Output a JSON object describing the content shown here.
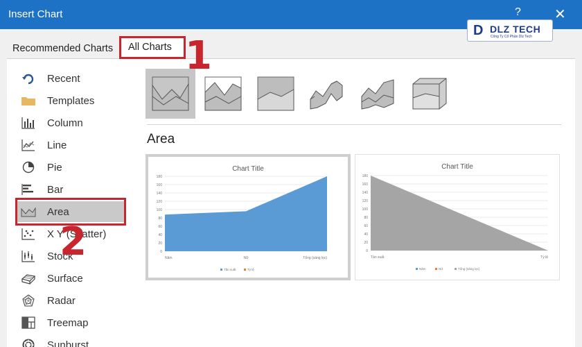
{
  "window": {
    "title": "Insert Chart",
    "help": "?",
    "close": "✕"
  },
  "logo": {
    "mark": "D",
    "word": "DLZ TECH",
    "sub": "Công Ty Cổ Phần Dlz Tech"
  },
  "tabs": [
    {
      "label": "Recommended Charts",
      "selected": false
    },
    {
      "label": "All Charts",
      "selected": true
    }
  ],
  "annotations": {
    "n1": "1",
    "n2": "2"
  },
  "sidebar": {
    "items": [
      {
        "label": "Recent",
        "icon": "recent-icon"
      },
      {
        "label": "Templates",
        "icon": "folder-icon"
      },
      {
        "label": "Column",
        "icon": "column-chart-icon"
      },
      {
        "label": "Line",
        "icon": "line-chart-icon"
      },
      {
        "label": "Pie",
        "icon": "pie-chart-icon"
      },
      {
        "label": "Bar",
        "icon": "bar-chart-icon"
      },
      {
        "label": "Area",
        "icon": "area-chart-icon",
        "selected": true
      },
      {
        "label": "X Y (Scatter)",
        "icon": "scatter-chart-icon"
      },
      {
        "label": "Stock",
        "icon": "stock-chart-icon"
      },
      {
        "label": "Surface",
        "icon": "surface-chart-icon"
      },
      {
        "label": "Radar",
        "icon": "radar-chart-icon"
      },
      {
        "label": "Treemap",
        "icon": "treemap-chart-icon"
      },
      {
        "label": "Sunburst",
        "icon": "sunburst-chart-icon"
      }
    ]
  },
  "section_title": "Area",
  "subtypes": [
    "area",
    "stacked-area",
    "100-stacked-area",
    "3d-area",
    "3d-stacked-area",
    "3d-100-stacked-area"
  ],
  "chart_data": [
    {
      "type": "area",
      "title": "Chart Title",
      "categories": [
        "Năm",
        "Nữ",
        "Tổng (sáng lọc)"
      ],
      "series": [
        {
          "name": "Tần suất",
          "values": [
            88,
            96,
            180
          ]
        },
        {
          "name": "Tỷ lệ",
          "values": []
        }
      ],
      "ylim": [
        0,
        180
      ],
      "yticks": [
        "0",
        "20",
        "40",
        "60",
        "80",
        "100",
        "120",
        "140",
        "160",
        "180"
      ],
      "color": "#5b9bd5",
      "legend": "bottom"
    },
    {
      "type": "area",
      "title": "Chart Title",
      "categories": [
        "Tần suất",
        "Tỷ lệ"
      ],
      "series": [
        {
          "name": "Năm",
          "values": []
        },
        {
          "name": "Nữ",
          "values": []
        },
        {
          "name": "Tổng (sáng lọc)",
          "values": [
            180,
            0
          ]
        }
      ],
      "ylim": [
        0,
        180
      ],
      "yticks": [
        "0",
        "20",
        "40",
        "60",
        "80",
        "100",
        "120",
        "140",
        "160",
        "180"
      ],
      "color": "#a5a5a5",
      "legend": "bottom"
    }
  ]
}
